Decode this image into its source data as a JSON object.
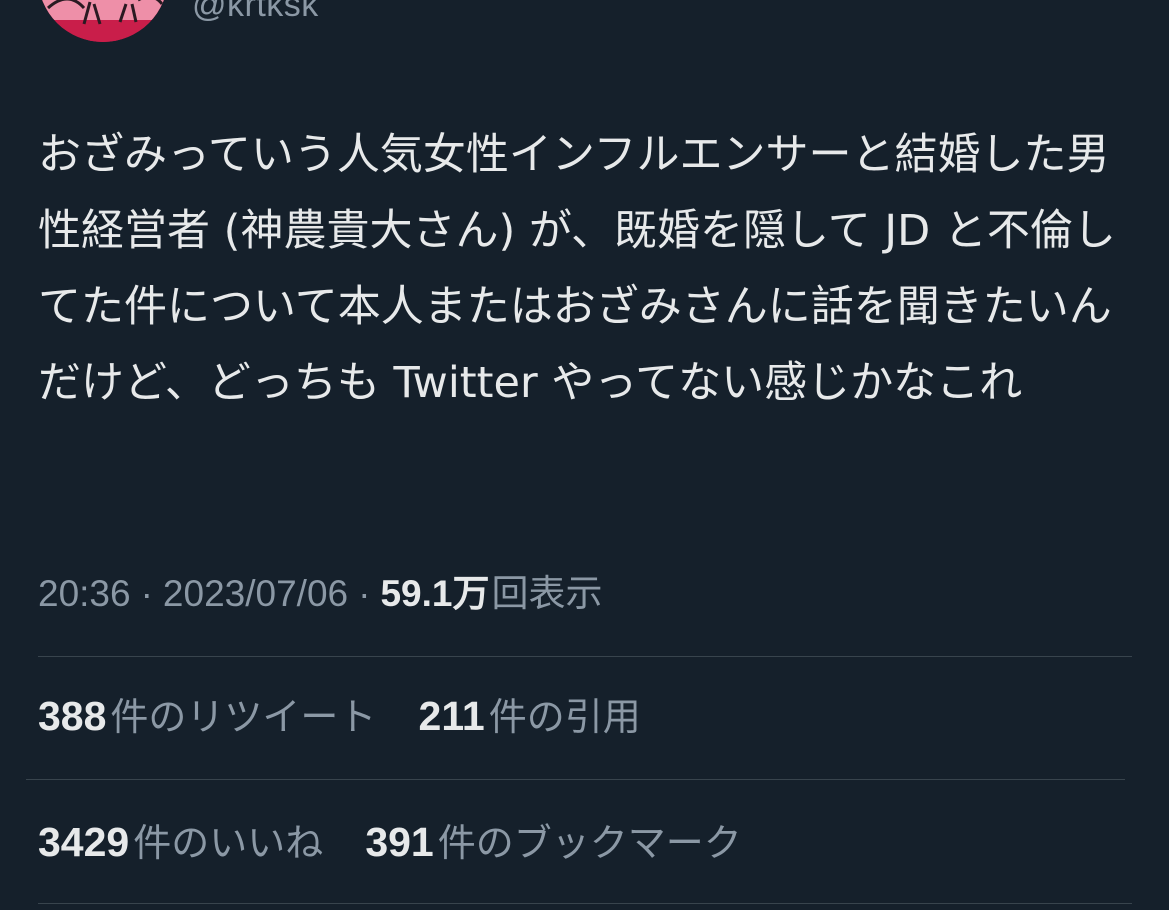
{
  "author": {
    "handle": "@krtksk"
  },
  "tweet": {
    "text": "おざみっていう人気女性インフルエンサーと結婚した男性経営者 (神農貴大さん) が、既婚を隠して JD と不倫してた件について本人またはおざみさんに話を聞きたいんだけど、どっちも Twitter やってない感じかなこれ",
    "time": "20:36",
    "separator": "·",
    "date": "2023/07/06",
    "views_count": "59.1万",
    "views_label": "回表示"
  },
  "stats": {
    "retweets_count": "388",
    "retweets_label": "件のリツイート",
    "quotes_count": "211",
    "quotes_label": "件の引用",
    "likes_count": "3429",
    "likes_label": "件のいいね",
    "bookmarks_count": "391",
    "bookmarks_label": "件のブックマーク"
  },
  "colors": {
    "background": "#15202b",
    "primary_text": "#e7e9ea",
    "secondary_text": "#8b98a5",
    "divider": "#38444d",
    "avatar_bg": "#c91e4a"
  }
}
